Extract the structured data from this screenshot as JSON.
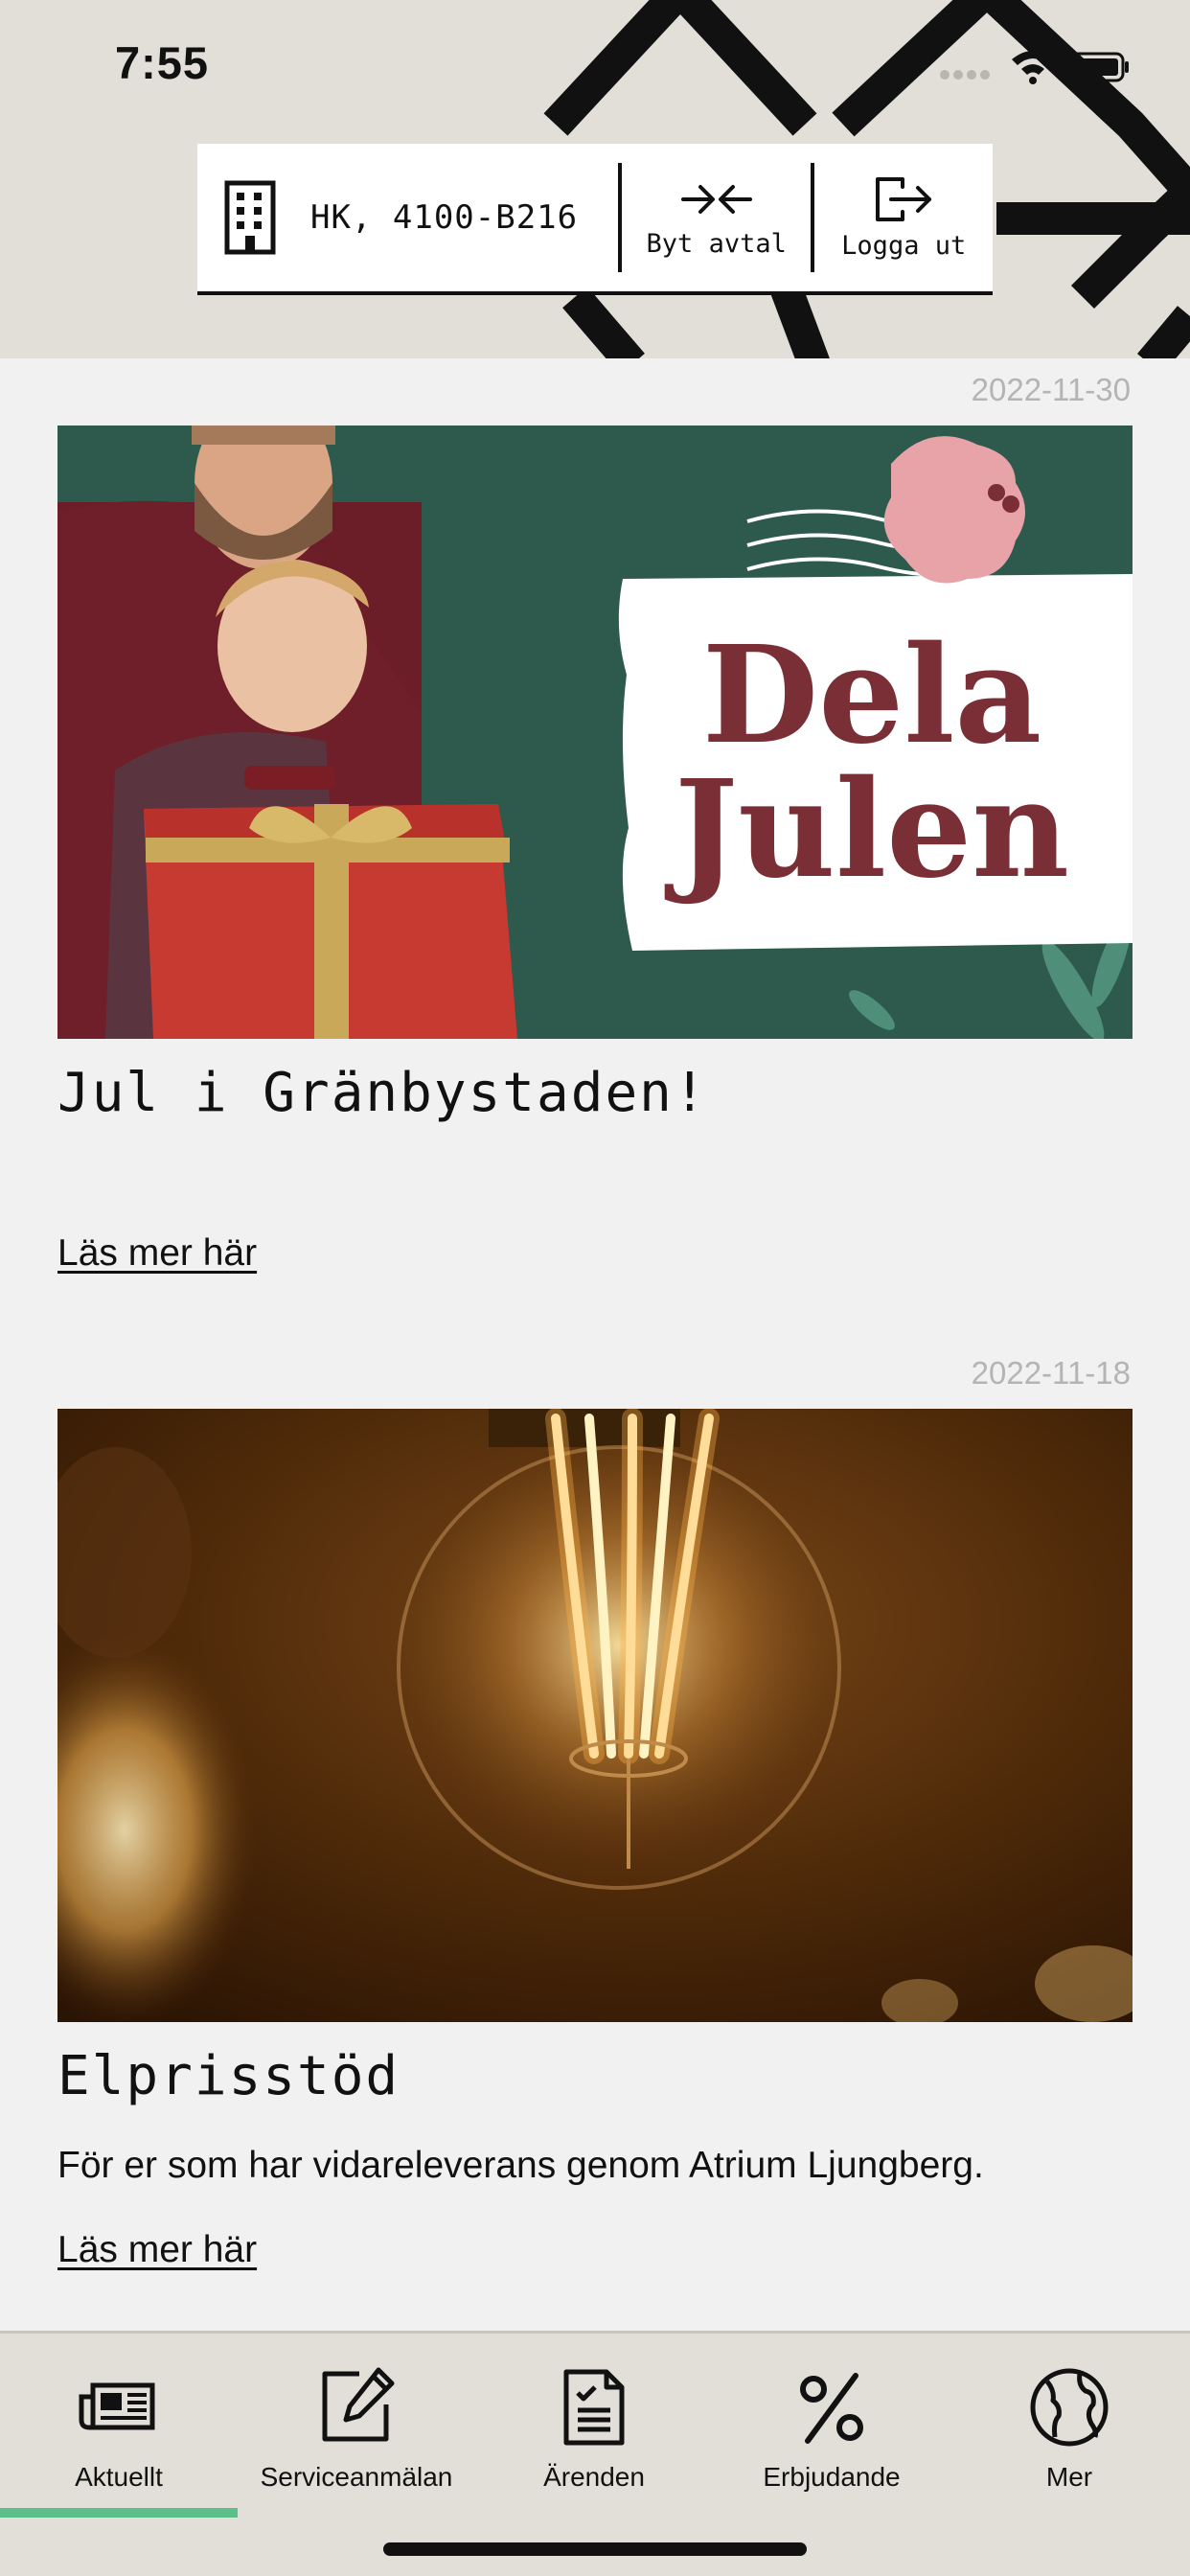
{
  "status_bar": {
    "time": "7:55"
  },
  "account_bar": {
    "account_label": "HK, 4100-B216",
    "switch_label": "Byt avtal",
    "logout_label": "Logga ut"
  },
  "news": [
    {
      "date": "2022-11-30",
      "image_text_line1": "Dela",
      "image_text_line2": "Julen",
      "title": "Jul i Gränbystaden!",
      "body": "",
      "link": "Läs mer här"
    },
    {
      "date": "2022-11-18",
      "title": "Elprisstöd",
      "body": "För er som har vidareleverans genom Atrium Ljungberg.",
      "link": "Läs mer här"
    }
  ],
  "tabs": [
    {
      "label": "Aktuellt",
      "icon": "newspaper-icon",
      "active": true
    },
    {
      "label": "Serviceanmälan",
      "icon": "edit-icon",
      "active": false
    },
    {
      "label": "Ärenden",
      "icon": "document-check-icon",
      "active": false
    },
    {
      "label": "Erbjudande",
      "icon": "percent-icon",
      "active": false
    },
    {
      "label": "Mer",
      "icon": "globe-icon",
      "active": false
    }
  ],
  "colors": {
    "header_bg": "#e2dfd8",
    "content_bg": "#f1f1f1",
    "active_tab_indicator": "#5cbf8a",
    "card_green": "#2d5a4d",
    "card_title_red": "#7a2e35"
  }
}
